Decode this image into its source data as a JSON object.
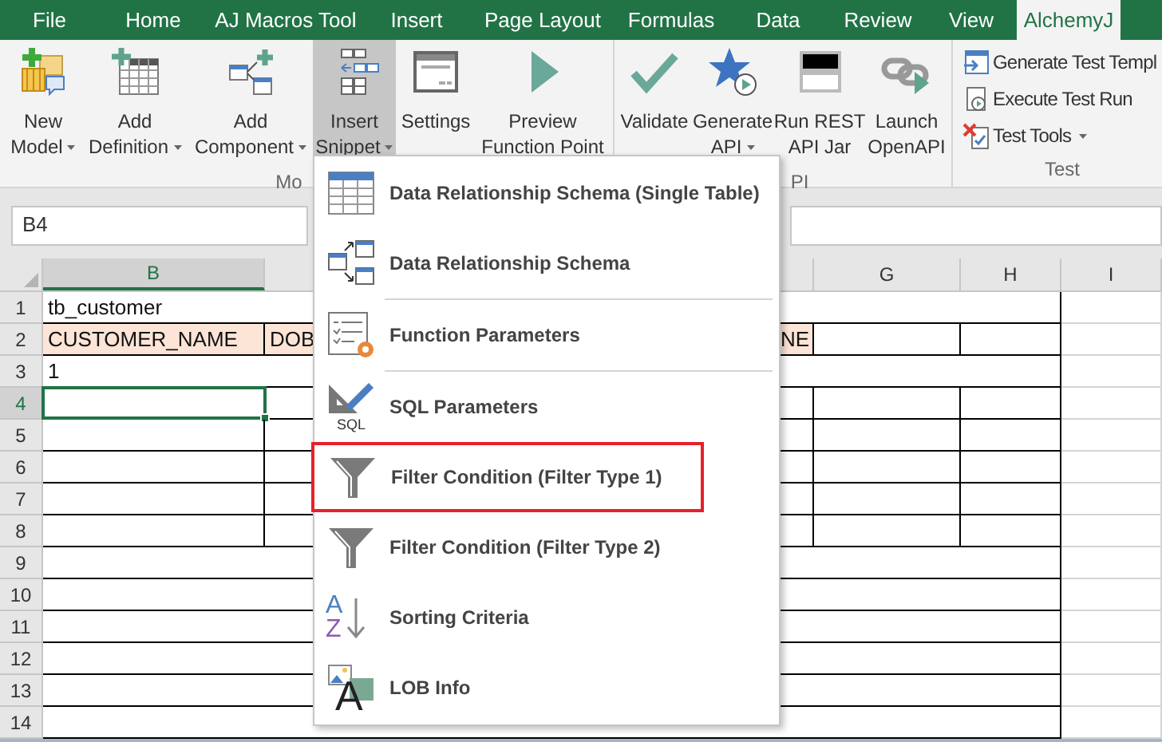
{
  "tabs": [
    {
      "label": "File",
      "selected": false
    },
    {
      "label": "Home",
      "selected": false
    },
    {
      "label": "AJ Macros Tool",
      "selected": false
    },
    {
      "label": "Insert",
      "selected": false
    },
    {
      "label": "Page Layout",
      "selected": false
    },
    {
      "label": "Formulas",
      "selected": false
    },
    {
      "label": "Data",
      "selected": false
    },
    {
      "label": "Review",
      "selected": false
    },
    {
      "label": "View",
      "selected": false
    },
    {
      "label": "AlchemyJ",
      "selected": true
    }
  ],
  "ribbon": {
    "groups": [
      {
        "label": "Mo",
        "buttons": [
          {
            "kind": "new-model",
            "lines": [
              "New",
              "Model"
            ],
            "dropdown": true,
            "expanded": false
          },
          {
            "kind": "add-definition",
            "lines": [
              "Add",
              "Definition"
            ],
            "dropdown": true,
            "expanded": false
          },
          {
            "kind": "add-component",
            "lines": [
              "Add",
              "Component"
            ],
            "dropdown": true,
            "expanded": false
          },
          {
            "kind": "insert-snippet",
            "lines": [
              "Insert",
              "Snippet"
            ],
            "dropdown": true,
            "expanded": true
          },
          {
            "kind": "settings",
            "lines": [
              "Settings"
            ],
            "dropdown": false,
            "expanded": false
          },
          {
            "kind": "preview",
            "lines": [
              "Preview",
              "Function Point"
            ],
            "dropdown": false,
            "expanded": false
          }
        ]
      },
      {
        "label": "PI",
        "buttons": [
          {
            "kind": "validate",
            "lines": [
              "Validate"
            ],
            "dropdown": false,
            "expanded": false
          },
          {
            "kind": "generate-api",
            "lines": [
              "Generate",
              "API"
            ],
            "dropdown": true,
            "expanded": false
          },
          {
            "kind": "run-rest",
            "lines": [
              "Run REST",
              "API Jar"
            ],
            "dropdown": false,
            "expanded": false
          },
          {
            "kind": "launch-openapi",
            "lines": [
              "Launch",
              "OpenAPI"
            ],
            "dropdown": false,
            "expanded": false
          }
        ]
      },
      {
        "label": "Test",
        "small_buttons": [
          {
            "kind": "generate-template",
            "label": "Generate Test Templ",
            "dropdown": false
          },
          {
            "kind": "execute-run",
            "label": "Execute Test Run",
            "dropdown": false
          },
          {
            "kind": "test-tools",
            "label": "Test Tools",
            "dropdown": true
          }
        ]
      }
    ]
  },
  "name_box": "B4",
  "sheet": {
    "columns": [
      {
        "label": "B",
        "selected": true
      },
      {
        "label": "G",
        "selected": false
      },
      {
        "label": "H",
        "selected": false
      },
      {
        "label": "I",
        "selected": false
      }
    ],
    "rows": [
      {
        "number": "1",
        "kind": "merged",
        "selected": false,
        "column_b": "tb_customer"
      },
      {
        "number": "2",
        "kind": "header",
        "selected": false,
        "column_b": "CUSTOMER_NAME",
        "column_c": "DOB",
        "column_f": "NE"
      },
      {
        "number": "3",
        "kind": "merged",
        "selected": false,
        "column_b": "1"
      },
      {
        "number": "4",
        "kind": "grid",
        "selected": true
      },
      {
        "number": "5",
        "kind": "grid",
        "selected": false
      },
      {
        "number": "6",
        "kind": "grid",
        "selected": false
      },
      {
        "number": "7",
        "kind": "grid",
        "selected": false
      },
      {
        "number": "8",
        "kind": "grid",
        "selected": false
      },
      {
        "number": "9",
        "kind": "merged",
        "selected": false
      },
      {
        "number": "10",
        "kind": "merged",
        "selected": false
      },
      {
        "number": "11",
        "kind": "merged",
        "selected": false
      },
      {
        "number": "12",
        "kind": "merged",
        "selected": false
      },
      {
        "number": "13",
        "kind": "merged",
        "selected": false
      },
      {
        "number": "14",
        "kind": "merged",
        "selected": false
      }
    ]
  },
  "snippet_menu": {
    "items": [
      {
        "kind": "table",
        "label": "Data Relationship Schema (Single Table)",
        "outlined": false,
        "divider": false
      },
      {
        "kind": "linked-tables",
        "label": "Data Relationship Schema",
        "outlined": false,
        "divider": true
      },
      {
        "kind": "checklist-gear",
        "label": "Function Parameters",
        "outlined": false,
        "divider": true
      },
      {
        "kind": "ruler-pencil",
        "label": "SQL Parameters",
        "outlined": false,
        "divider": false,
        "icon_letters": [
          {
            "text": "SQL",
            "color": "#333333"
          }
        ]
      },
      {
        "kind": "funnel",
        "label": "Filter Condition (Filter Type 1)",
        "outlined": true,
        "divider": false
      },
      {
        "kind": "funnel",
        "label": "Filter Condition (Filter Type 2)",
        "outlined": false,
        "divider": false
      },
      {
        "kind": "sort",
        "label": "Sorting Criteria",
        "outlined": false,
        "divider": false,
        "icon_letters": [
          {
            "text": "A",
            "color": "#4a7fc1"
          },
          {
            "text": "Z",
            "color": "#8e5bb5"
          }
        ]
      },
      {
        "kind": "image-letter",
        "label": "LOB Info",
        "outlined": false,
        "divider": false,
        "icon_letters": [
          {
            "text": "A",
            "color": "#222222"
          }
        ]
      }
    ]
  }
}
